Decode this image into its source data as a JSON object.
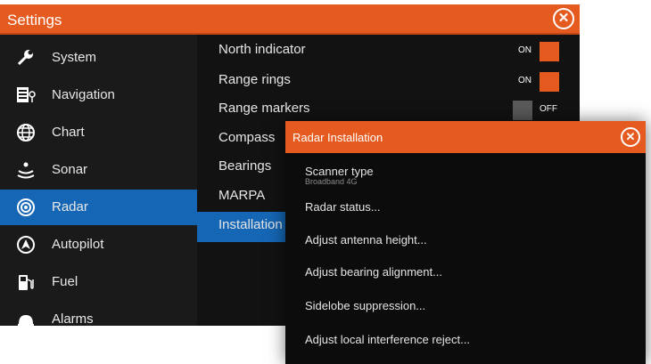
{
  "settings": {
    "title": "Settings",
    "close_icon": "close-icon",
    "sidebar": {
      "items": [
        {
          "label": "System",
          "icon": "wrench-icon",
          "active": false
        },
        {
          "label": "Navigation",
          "icon": "navigation-icon",
          "active": false
        },
        {
          "label": "Chart",
          "icon": "globe-icon",
          "active": false
        },
        {
          "label": "Sonar",
          "icon": "sonar-icon",
          "active": false
        },
        {
          "label": "Radar",
          "icon": "radar-icon",
          "active": true
        },
        {
          "label": "Autopilot",
          "icon": "autopilot-icon",
          "active": false
        },
        {
          "label": "Fuel",
          "icon": "fuel-icon",
          "active": false
        },
        {
          "label": "Alarms",
          "icon": "alarm-icon",
          "active": false
        }
      ]
    },
    "radar_options": {
      "rows": [
        {
          "label": "North indicator",
          "toggle": "ON"
        },
        {
          "label": "Range rings",
          "toggle": "ON"
        },
        {
          "label": "Range markers",
          "toggle": "OFF"
        },
        {
          "label": "Compass"
        },
        {
          "label": "Bearings"
        },
        {
          "label": "MARPA"
        },
        {
          "label": "Installation",
          "active": true
        }
      ]
    }
  },
  "dialog": {
    "title": "Radar Installation",
    "close_icon": "close-icon",
    "items": [
      {
        "label": "Scanner type",
        "sub": "Broadband 4G"
      },
      {
        "label": "Radar status..."
      },
      {
        "label": "Adjust antenna height..."
      },
      {
        "label": "Adjust bearing alignment..."
      },
      {
        "label": "Sidelobe suppression..."
      },
      {
        "label": "Adjust local interference reject..."
      }
    ]
  },
  "colors": {
    "accent": "#e55a1f",
    "selection": "#1566b4",
    "background": "#101010"
  }
}
